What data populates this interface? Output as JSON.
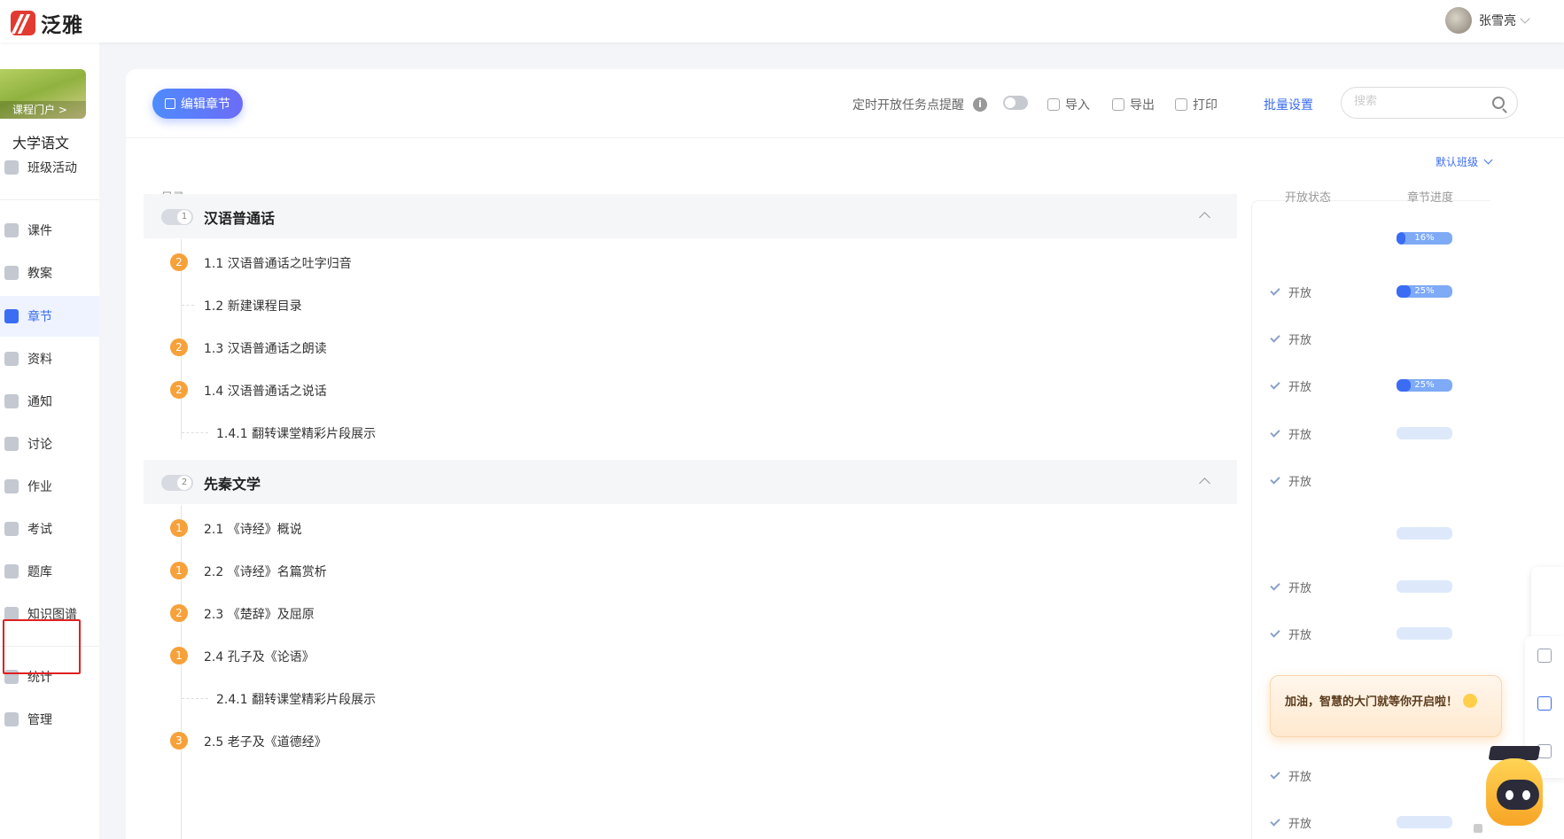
{
  "header": {
    "logo_text": "泛雅",
    "user_name": "张雪亮"
  },
  "sidebar": {
    "course_portal": "课程门户 >",
    "course_name": "大学语文",
    "items": [
      {
        "label": "班级活动",
        "icon": "grid-icon"
      },
      {
        "label": "课件",
        "icon": "ppt-icon"
      },
      {
        "label": "教案",
        "icon": "lesson-plan-icon"
      },
      {
        "label": "章节",
        "icon": "list-icon",
        "active": true
      },
      {
        "label": "资料",
        "icon": "folder-icon"
      },
      {
        "label": "通知",
        "icon": "megaphone-icon"
      },
      {
        "label": "讨论",
        "icon": "chat-icon"
      },
      {
        "label": "作业",
        "icon": "edit-icon"
      },
      {
        "label": "考试",
        "icon": "exam-icon"
      },
      {
        "label": "题库",
        "icon": "layers-icon",
        "highlighted": true
      },
      {
        "label": "知识图谱",
        "icon": "graph-icon"
      },
      {
        "label": "统计",
        "icon": "pie-icon"
      },
      {
        "label": "管理",
        "icon": "gear-icon"
      }
    ]
  },
  "toolbar": {
    "edit_chapter": "编辑章节",
    "timed_open_reminder": "定时开放任务点提醒",
    "import": "导入",
    "export": "导出",
    "print": "打印",
    "batch_settings": "批量设置",
    "search_placeholder": "搜索"
  },
  "toc": {
    "label": "目录",
    "class_select": "默认班级",
    "col_status": "开放状态",
    "col_progress": "章节进度",
    "open_text": "开放"
  },
  "chapters": [
    {
      "num": "1",
      "title": "汉语普通话",
      "progress": 16,
      "sections": [
        {
          "badge": "2",
          "title": "1.1 汉语普通话之吐字归音",
          "status": "开放",
          "progress": 25
        },
        {
          "badge": "",
          "title": "1.2 新建课程目录",
          "status": "开放",
          "progress": null
        },
        {
          "badge": "2",
          "title": "1.3 汉语普通话之朗读",
          "status": "开放",
          "progress": 25
        },
        {
          "badge": "2",
          "title": "1.4 汉语普通话之说话",
          "status": "开放",
          "progress": 0
        },
        {
          "badge": "",
          "title": "1.4.1 翻转课堂精彩片段展示",
          "status": "开放",
          "progress": null,
          "sub": true
        }
      ]
    },
    {
      "num": "2",
      "title": "先秦文学",
      "progress": 0,
      "sections": [
        {
          "badge": "1",
          "title": "2.1 《诗经》概说",
          "status": "开放",
          "progress": 0
        },
        {
          "badge": "1",
          "title": "2.2 《诗经》名篇赏析",
          "status": "开放",
          "progress": 0
        },
        {
          "badge": "2",
          "title": "2.3 《楚辞》及屈原",
          "status": "",
          "progress": null
        },
        {
          "badge": "1",
          "title": "2.4 孔子及《论语》",
          "status": "",
          "progress": null
        },
        {
          "badge": "",
          "title": "2.4.1 翻转课堂精彩片段展示",
          "status": "开放",
          "progress": null,
          "sub": true
        },
        {
          "badge": "3",
          "title": "2.5 老子及《道德经》",
          "status": "开放",
          "progress": 0
        }
      ]
    }
  ],
  "tip": {
    "text": "加油，智慧的大门就等你开启啦！"
  }
}
